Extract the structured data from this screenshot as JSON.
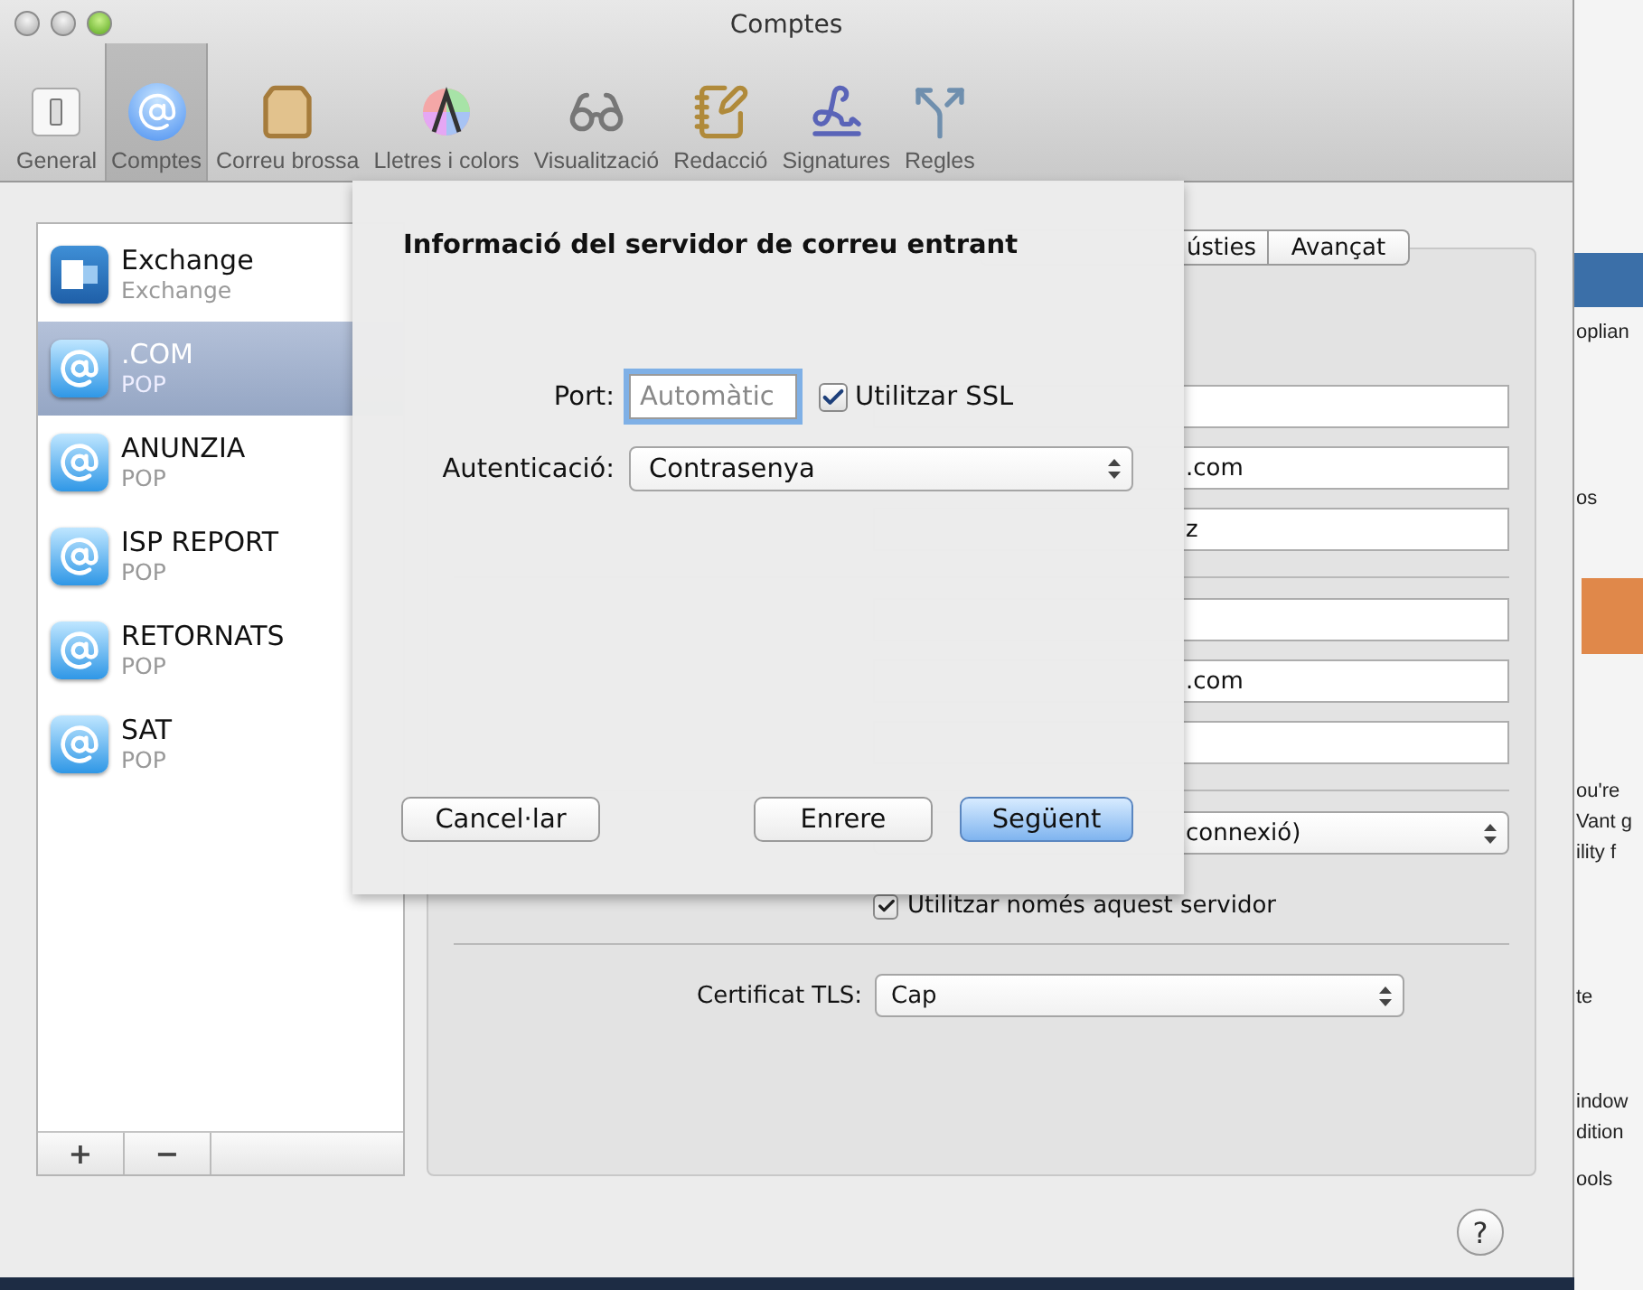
{
  "window": {
    "title": "Comptes"
  },
  "toolbar": [
    {
      "label": "General",
      "kind": "general",
      "selected": false
    },
    {
      "label": "Comptes",
      "kind": "accounts",
      "selected": true
    },
    {
      "label": "Correu brossa",
      "kind": "junk",
      "selected": false
    },
    {
      "label": "Lletres i colors",
      "kind": "fonts",
      "selected": false
    },
    {
      "label": "Visualització",
      "kind": "viewing",
      "selected": false
    },
    {
      "label": "Redacció",
      "kind": "composing",
      "selected": false
    },
    {
      "label": "Signatures",
      "kind": "signatures",
      "selected": false
    },
    {
      "label": "Regles",
      "kind": "rules",
      "selected": false
    }
  ],
  "accounts": [
    {
      "name": "Exchange",
      "type": "Exchange",
      "kind": "exchange",
      "selected": false
    },
    {
      "name": ".COM",
      "type": "POP",
      "kind": "pop",
      "selected": true
    },
    {
      "name": "ANUNZIA",
      "type": "POP",
      "kind": "pop",
      "selected": false
    },
    {
      "name": "ISP REPORT",
      "type": "POP",
      "kind": "pop",
      "selected": false
    },
    {
      "name": "RETORNATS",
      "type": "POP",
      "kind": "pop",
      "selected": false
    },
    {
      "name": "SAT",
      "type": "POP",
      "kind": "pop",
      "selected": false
    }
  ],
  "account_buttons": [
    "+",
    "−"
  ],
  "tabs": [
    {
      "label": "ústies",
      "selected": false
    },
    {
      "label": "Avançat",
      "selected": false
    }
  ],
  "fields": [
    {
      "kind": "text"
    },
    {
      "kind": "text",
      "value": ".com"
    },
    {
      "kind": "text",
      "value": "z"
    },
    {
      "kind": "separator"
    },
    {
      "kind": "text"
    },
    {
      "kind": "text",
      "value": ".com"
    },
    {
      "kind": "text"
    },
    {
      "kind": "separator"
    },
    {
      "kind": "popup",
      "value": "connexió)"
    }
  ],
  "only_this_server": {
    "label": "Utilitzar només aquest servidor",
    "checked": true
  },
  "tls": {
    "label": "Certificat TLS:",
    "value": "Cap"
  },
  "help_button": "?",
  "sheet": {
    "title": "Informació del servidor de correu entrant",
    "port": {
      "label": "Port:",
      "placeholder": "Automàtic",
      "focused": true
    },
    "ssl": {
      "label": "Utilitzar SSL",
      "checked": true
    },
    "authentication": {
      "label": "Autenticació:",
      "value": "Contrasenya"
    },
    "buttons": [
      {
        "label": "Cancel·lar",
        "kind": "cancel"
      },
      {
        "label": "Enrere",
        "kind": "normal"
      },
      {
        "label": "Següent",
        "kind": "default"
      }
    ]
  },
  "background_window": {
    "texts": [
      "oplian",
      "os",
      "ou're",
      "Vant g",
      "ility f",
      "te",
      "indow",
      "dition",
      "ools"
    ]
  }
}
